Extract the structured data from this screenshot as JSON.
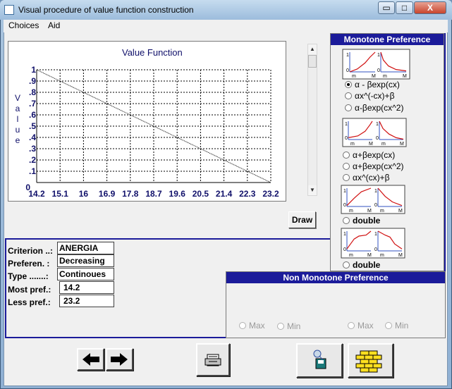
{
  "window": {
    "title": "Visual procedure of value function construction",
    "min_glyph": "▭",
    "max_glyph": "□",
    "close_glyph": "X"
  },
  "menu": {
    "items": [
      "Choices",
      "Aid"
    ]
  },
  "chart": {
    "ylabel_letters": [
      "V",
      "a",
      "l",
      "u",
      "e"
    ],
    "draw_label": "Draw"
  },
  "chart_data": {
    "type": "line",
    "title": "Value Function",
    "xlabel": "",
    "ylabel": "Value",
    "x_ticks": [
      "14.2",
      "15.1",
      "16",
      "16.9",
      "17.8",
      "18.7",
      "19.6",
      "20.5",
      "21.4",
      "22.3",
      "23.2"
    ],
    "y_ticks": [
      "0",
      ".1",
      ".2",
      ".3",
      ".4",
      ".5",
      ".6",
      ".7",
      ".8",
      ".9",
      "1"
    ],
    "xlim": [
      14.2,
      23.2
    ],
    "ylim": [
      0,
      1
    ],
    "grid": true,
    "series": [
      {
        "x": [
          14.2,
          23.2
        ],
        "y": [
          1,
          0
        ]
      }
    ]
  },
  "mono": {
    "title": "Monotone Preference",
    "g1": [
      "α - βexp(cx)",
      "αx^(-cx)+β",
      "α-βexp(cx^2)"
    ],
    "g2": [
      "α+βexp(cx)",
      "α+βexp(cx^2)",
      "αx^(cx)+β"
    ],
    "g3": "double",
    "g4": "double",
    "selected": "α - βexp(cx)"
  },
  "nonmono": {
    "title": "Non Monotone Preference",
    "max": "Max",
    "min": "Min"
  },
  "thumb_labels": {
    "m": "m",
    "M": "M",
    "one": "1",
    "zero": "0"
  },
  "info": {
    "criterion_label": "Criterion ..:",
    "criterion": "ANERGIA",
    "preference_label": "Preferen. :",
    "preference": "Decreasing",
    "type_label": "Type .......:",
    "type": "Continoues",
    "most_label": "Most pref.:",
    "most": "14.2",
    "less_label": "Less pref.:",
    "less": "23.2"
  },
  "colors": {
    "navy": "#1b1b9a",
    "curve": "#d01010",
    "axis_blue": "#10106a"
  }
}
